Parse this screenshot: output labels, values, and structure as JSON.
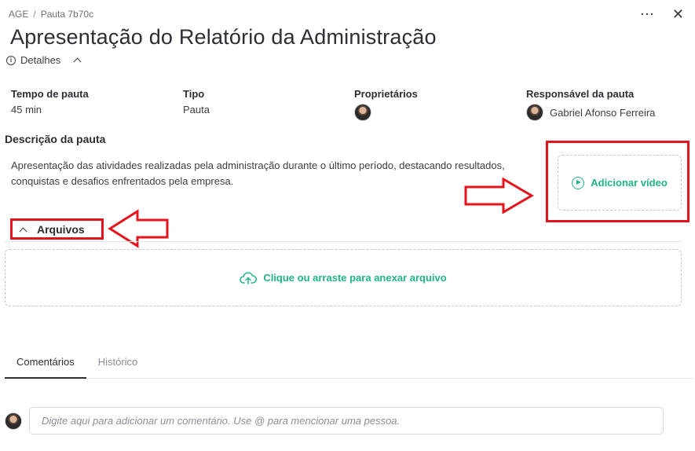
{
  "breadcrumb": {
    "parent": "AGE",
    "separator": "/",
    "current": "Pauta 7b70c"
  },
  "header": {
    "more_icon": "⋯",
    "close_icon": "✕",
    "title": "Apresentação do Relatório da Administração"
  },
  "details": {
    "label": "Detalhes"
  },
  "meta": {
    "duration": {
      "label": "Tempo de pauta",
      "value": "45 min"
    },
    "type": {
      "label": "Tipo",
      "value": "Pauta"
    },
    "owners": {
      "label": "Proprietários"
    },
    "responsible": {
      "label": "Responsável da pauta",
      "value": "Gabriel Afonso Ferreira"
    }
  },
  "description": {
    "title": "Descrição da pauta",
    "text": "Apresentação das atividades realizadas pela administração durante o último período, destacando resultados, conquistas e desafios enfrentados pela empresa."
  },
  "video": {
    "label": "Adicionar vídeo"
  },
  "files": {
    "title": "Arquivos",
    "drop_label": "Clique ou arraste para anexar arquivo"
  },
  "tabs": [
    {
      "label": "Comentários",
      "active": true
    },
    {
      "label": "Histórico",
      "active": false
    }
  ],
  "comment": {
    "placeholder": "Digite aqui para adicionar um comentário. Use @ para mencionar uma pessoa."
  },
  "colors": {
    "accent": "#1fb488",
    "annotation_red": "#e5141c",
    "text": "#2b2f33"
  }
}
